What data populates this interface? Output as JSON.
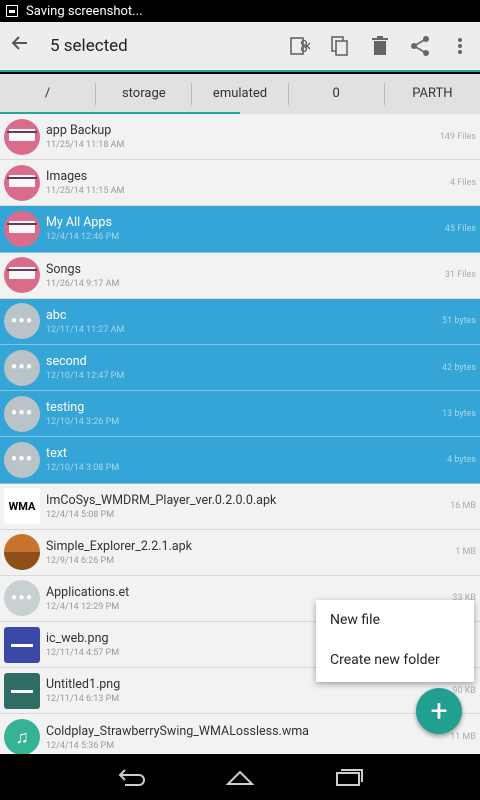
{
  "status": {
    "text": "Saving screenshot..."
  },
  "toolbar": {
    "title": "5 selected"
  },
  "crumbs": [
    "/",
    "storage",
    "emulated",
    "0",
    "PARTH"
  ],
  "files": [
    {
      "name": "app Backup",
      "date": "11/25/14 11:18 AM",
      "size": "149 Files",
      "icon": "folder",
      "selected": false
    },
    {
      "name": "Images",
      "date": "11/25/14 11:15 AM",
      "size": "4 Files",
      "icon": "folder",
      "selected": false
    },
    {
      "name": "My All Apps",
      "date": "12/4/14 12:46 PM",
      "size": "45 Files",
      "icon": "folder",
      "selected": true
    },
    {
      "name": "Songs",
      "date": "11/26/14 9:17 AM",
      "size": "31 Files",
      "icon": "folder",
      "selected": false
    },
    {
      "name": "abc",
      "date": "12/11/14 11:27 AM",
      "size": "51 bytes",
      "icon": "dots",
      "selected": true
    },
    {
      "name": "second",
      "date": "12/10/14 12:47 PM",
      "size": "42 bytes",
      "icon": "dots",
      "selected": true
    },
    {
      "name": "testing",
      "date": "12/10/14 3:26 PM",
      "size": "13 bytes",
      "icon": "dots",
      "selected": true
    },
    {
      "name": "text",
      "date": "12/10/14 3:08 PM",
      "size": "4 bytes",
      "icon": "dots",
      "selected": true
    },
    {
      "name": "ImCoSys_WMDRM_Player_ver.0.2.0.0.apk",
      "date": "12/4/14 5:08 PM",
      "size": "16 MB",
      "icon": "wma",
      "selected": false
    },
    {
      "name": "Simple_Explorer_2.2.1.apk",
      "date": "12/9/14 6:26 PM",
      "size": "1 MB",
      "icon": "apk",
      "selected": false
    },
    {
      "name": "Applications.et",
      "date": "12/4/14 12:29 PM",
      "size": "33 KB",
      "icon": "dots",
      "selected": false
    },
    {
      "name": "ic_web.png",
      "date": "12/11/14 4:57 PM",
      "size": "",
      "icon": "img-blue",
      "selected": false
    },
    {
      "name": "Untitled1.png",
      "date": "12/11/14 6:13 PM",
      "size": "90 KB",
      "icon": "img-teal",
      "selected": false
    },
    {
      "name": "Coldplay_StrawberrySwing_WMALossless.wma",
      "date": "12/4/14 5:36 PM",
      "size": "11 MB",
      "icon": "music",
      "selected": false
    }
  ],
  "menu": {
    "new_file": "New file",
    "new_folder": "Create new folder"
  },
  "fab": {
    "label": "+"
  },
  "icons": {
    "wma_text": "WMA",
    "music_glyph": "♫"
  },
  "colors": {
    "accent": "#27a69a",
    "selected": "#34a5d6",
    "fab": "#21a08f"
  }
}
